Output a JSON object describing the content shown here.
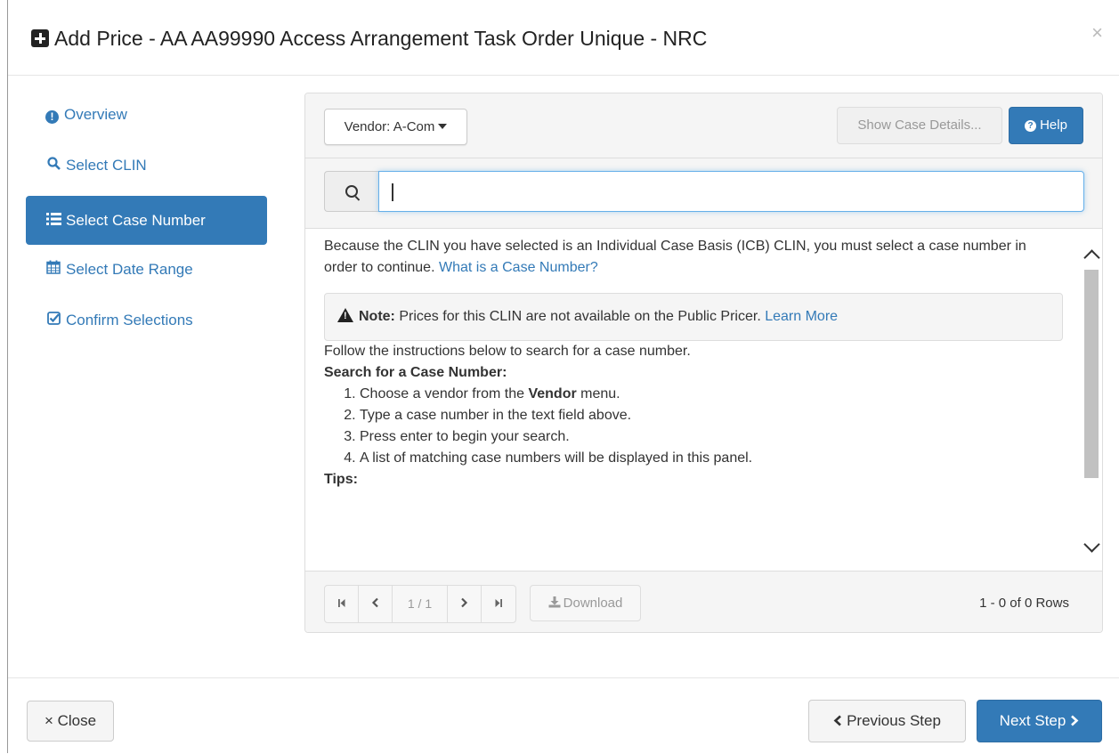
{
  "modal": {
    "title": "Add Price - AA AA99990 Access Arrangement Task Order Unique - NRC",
    "close_icon": "×"
  },
  "nav": {
    "items": [
      {
        "label": "Overview",
        "icon": "exclamation-circle-icon",
        "active": false
      },
      {
        "label": "Select CLIN",
        "icon": "search-icon",
        "active": false
      },
      {
        "label": "Select Case Number",
        "icon": "list-icon",
        "active": true
      },
      {
        "label": "Select Date Range",
        "icon": "calendar-icon",
        "active": false
      },
      {
        "label": "Confirm Selections",
        "icon": "check-square-icon",
        "active": false
      }
    ]
  },
  "toolbar": {
    "vendor_label": "Vendor: A-Com",
    "show_case_label": "Show Case Details...",
    "help_label": "Help"
  },
  "search": {
    "placeholder": "",
    "value": ""
  },
  "content": {
    "intro": "Because the CLIN you have selected is an Individual Case Basis (ICB) CLIN, you must select a case number in order to continue.",
    "intro_link": "What is a Case Number?",
    "note_label": "Note:",
    "note_text": "Prices for this CLIN are not available on the Public Pricer.",
    "note_link": "Learn More",
    "follow": "Follow the instructions below to search for a case number.",
    "search_heading": "Search for a Case Number:",
    "step1_pre": "Choose a vendor from the",
    "step1_bold": "Vendor",
    "step1_post": "menu.",
    "step2": "Type a case number in the text field above.",
    "step3": "Press enter to begin your search.",
    "step4": "A list of matching case numbers will be displayed in this panel.",
    "tips_heading": "Tips:"
  },
  "pager": {
    "first": "⏮",
    "prev": "‹",
    "page": "1 / 1",
    "next": "›",
    "last": "⏭",
    "download_label": "Download",
    "rows_text": "1 - 0 of 0 Rows"
  },
  "footer": {
    "close_label": "× Close",
    "prev_label": "Previous Step",
    "next_label": "Next Step"
  },
  "colors": {
    "primary": "#337ab7",
    "panel_bg": "#f5f5f5"
  }
}
